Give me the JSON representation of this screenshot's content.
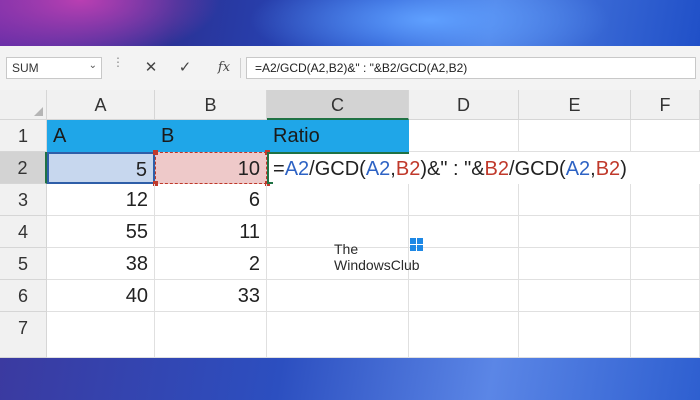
{
  "formula_bar": {
    "name_box": "SUM",
    "cancel_glyph": "✕",
    "enter_glyph": "✓",
    "fx_label": "fx",
    "formula": "=A2/GCD(A2,B2)&\" : \"&B2/GCD(A2,B2)"
  },
  "columns": [
    "A",
    "B",
    "C",
    "D",
    "E",
    "F"
  ],
  "rows": [
    "1",
    "2",
    "3",
    "4",
    "5",
    "6",
    "7"
  ],
  "cells": {
    "A1": "A",
    "B1": "B",
    "C1": "Ratio",
    "A2": "5",
    "B2": "10",
    "A3": "12",
    "B3": "6",
    "A4": "55",
    "B4": "11",
    "A5": "38",
    "B5": "2",
    "A6": "40",
    "B6": "33"
  },
  "edit_formula_parts": {
    "p1": "=",
    "p2": "A2",
    "p3": "/GCD(",
    "p4": "A2",
    "p5": ",",
    "p6": "B2",
    "p7": ")&\" : \"&",
    "p8": "B2",
    "p9": "/GCD(",
    "p10": "A2",
    "p11": ",",
    "p12": "B2",
    "p13": ")"
  },
  "watermark": {
    "line1": "The",
    "line2": "WindowsClub"
  },
  "colors": {
    "header_fill": "#1fa6e8",
    "ref_a": "#2e63c4",
    "ref_b": "#c0392b",
    "active_border": "#1f7244"
  }
}
